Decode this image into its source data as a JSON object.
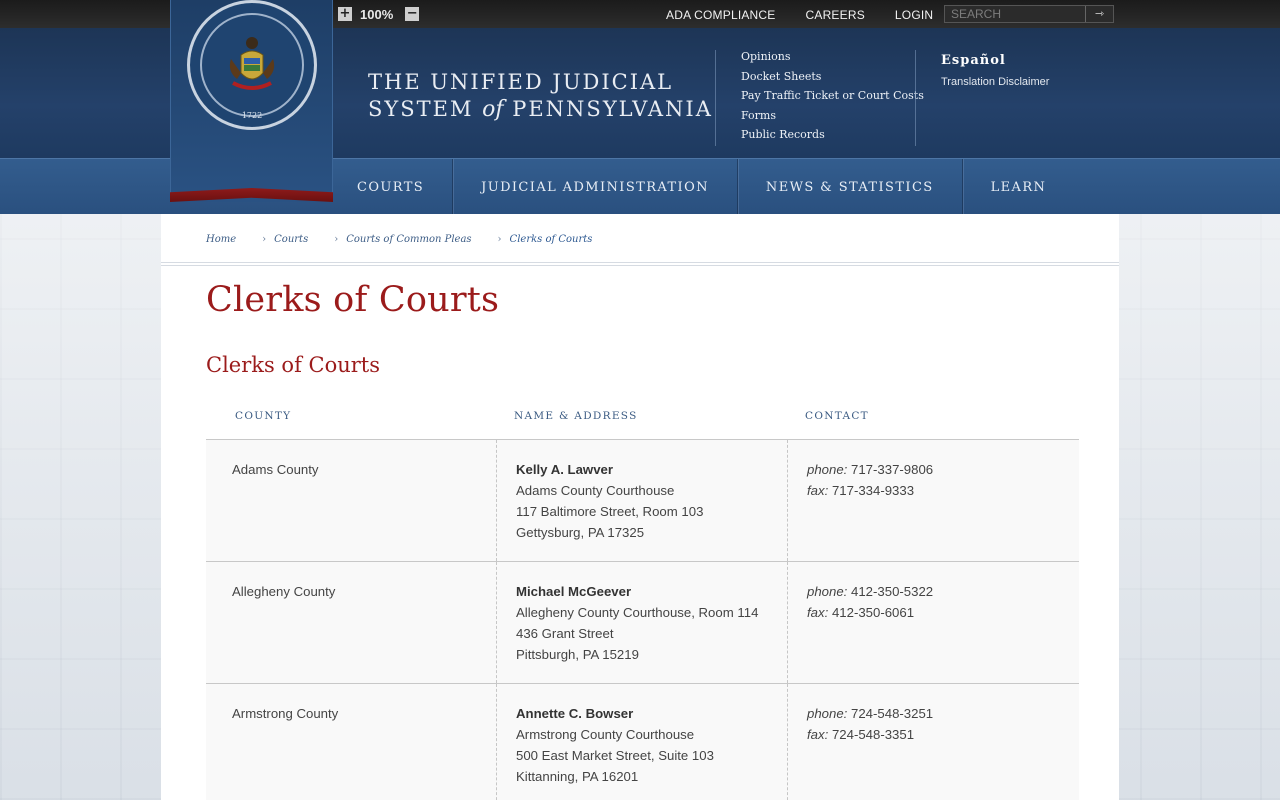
{
  "topbar": {
    "zoom_in": "+",
    "zoom_value": "100%",
    "zoom_out": "−",
    "links": [
      "ADA COMPLIANCE",
      "CAREERS",
      "LOGIN"
    ],
    "search_placeholder": "SEARCH",
    "search_go": "⇾"
  },
  "header": {
    "seal_year": "1722",
    "title_line1": "THE UNIFIED JUDICIAL",
    "title_line2_a": "SYSTEM ",
    "title_line2_of": "of",
    "title_line2_b": " PENNSYLVANIA",
    "quick_links": [
      "Opinions",
      "Docket Sheets",
      "Pay Traffic Ticket or Court Costs",
      "Forms",
      "Public Records"
    ],
    "language": "Español",
    "translation_disclaimer": "Translation Disclaimer"
  },
  "nav": [
    "COURTS",
    "JUDICIAL ADMINISTRATION",
    "NEWS & STATISTICS",
    "LEARN"
  ],
  "breadcrumb": [
    "Home",
    "Courts",
    "Courts of Common Pleas",
    "Clerks of Courts"
  ],
  "page_title": "Clerks of Courts",
  "section_title": "Clerks of Courts",
  "table": {
    "headers": [
      "COUNTY",
      "NAME & ADDRESS",
      "CONTACT"
    ],
    "phone_label": "phone:",
    "fax_label": "fax:",
    "rows": [
      {
        "county": "Adams County",
        "name": "Kelly A. Lawver",
        "address": [
          "Adams County Courthouse",
          "117 Baltimore Street, Room 103",
          "Gettysburg, PA 17325"
        ],
        "phone": "717-337-9806",
        "fax": "717-334-9333"
      },
      {
        "county": "Allegheny County",
        "name": "Michael McGeever",
        "address": [
          "Allegheny County Courthouse, Room 114",
          "436 Grant Street",
          "Pittsburgh, PA 15219"
        ],
        "phone": "412-350-5322",
        "fax": "412-350-6061"
      },
      {
        "county": "Armstrong County",
        "name": "Annette C. Bowser",
        "address": [
          "Armstrong County Courthouse",
          "500 East Market Street, Suite 103",
          "Kittanning, PA 16201"
        ],
        "phone": "724-548-3251",
        "fax": "724-548-3351"
      }
    ]
  }
}
